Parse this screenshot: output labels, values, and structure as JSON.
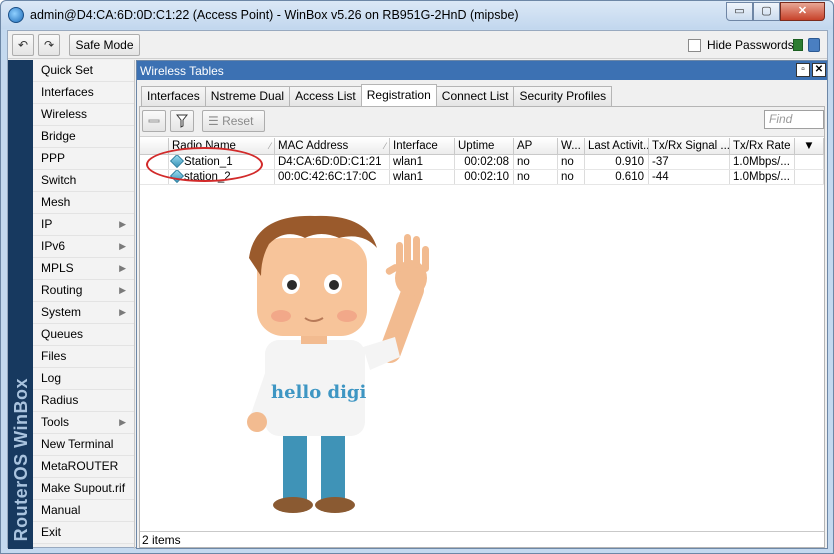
{
  "window": {
    "title": "admin@D4:CA:6D:0D:C1:22 (Access Point) - WinBox v5.26 on RB951G-2HnD (mipsbe)",
    "min_label": "▭",
    "max_label": "▢",
    "close_label": "✕"
  },
  "toolbar": {
    "undo_icon": "↶",
    "redo_icon": "↷",
    "safe_mode_label": "Safe Mode",
    "hide_passwords_label": "Hide Passwords"
  },
  "sidebar": {
    "brand": "RouterOS WinBox",
    "items": [
      {
        "label": "Quick Set",
        "submenu": false
      },
      {
        "label": "Interfaces",
        "submenu": false
      },
      {
        "label": "Wireless",
        "submenu": false
      },
      {
        "label": "Bridge",
        "submenu": false
      },
      {
        "label": "PPP",
        "submenu": false
      },
      {
        "label": "Switch",
        "submenu": false
      },
      {
        "label": "Mesh",
        "submenu": false
      },
      {
        "label": "IP",
        "submenu": true
      },
      {
        "label": "IPv6",
        "submenu": true
      },
      {
        "label": "MPLS",
        "submenu": true
      },
      {
        "label": "Routing",
        "submenu": true
      },
      {
        "label": "System",
        "submenu": true
      },
      {
        "label": "Queues",
        "submenu": false
      },
      {
        "label": "Files",
        "submenu": false
      },
      {
        "label": "Log",
        "submenu": false
      },
      {
        "label": "Radius",
        "submenu": false
      },
      {
        "label": "Tools",
        "submenu": true
      },
      {
        "label": "New Terminal",
        "submenu": false
      },
      {
        "label": "MetaROUTER",
        "submenu": false
      },
      {
        "label": "Make Supout.rif",
        "submenu": false
      },
      {
        "label": "Manual",
        "submenu": false
      },
      {
        "label": "Exit",
        "submenu": false
      }
    ]
  },
  "wireless_tables": {
    "title": "Wireless Tables",
    "tabs": [
      {
        "label": "Interfaces",
        "active": false
      },
      {
        "label": "Nstreme Dual",
        "active": false
      },
      {
        "label": "Access List",
        "active": false
      },
      {
        "label": "Registration",
        "active": true
      },
      {
        "label": "Connect List",
        "active": false
      },
      {
        "label": "Security Profiles",
        "active": false
      }
    ],
    "reset_label": "Reset",
    "find_placeholder": "Find",
    "columns": [
      "",
      "Radio Name",
      "MAC Address",
      "Interface",
      "Uptime",
      "AP",
      "W...",
      "Last Activit...",
      "Tx/Rx Signal ...",
      "Tx/Rx Rate",
      "▼"
    ],
    "rows": [
      {
        "radio_name": "Station_1",
        "mac": "D4:CA:6D:0D:C1:21",
        "interface": "wlan1",
        "uptime": "00:02:08",
        "ap": "no",
        "w": "no",
        "last_activity": "0.910",
        "signal": "-37",
        "rate": "1.0Mbps/..."
      },
      {
        "radio_name": "station_2",
        "mac": "00:0C:42:6C:17:0C",
        "interface": "wlan1",
        "uptime": "00:02:10",
        "ap": "no",
        "w": "no",
        "last_activity": "0.610",
        "signal": "-44",
        "rate": "1.0Mbps/..."
      }
    ],
    "status": "2 items"
  },
  "mascot": {
    "shirt_text": "hello digi"
  }
}
